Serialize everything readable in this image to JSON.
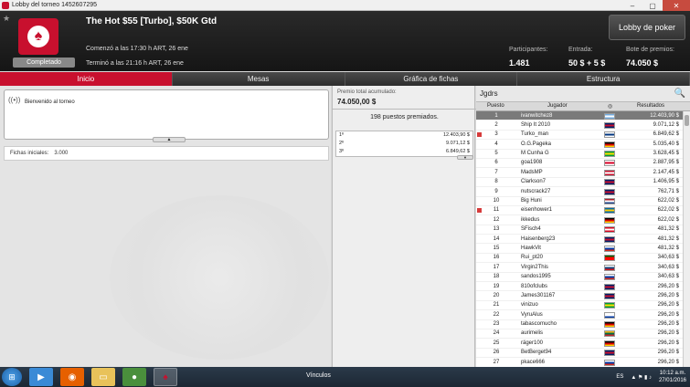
{
  "window": {
    "title": "Lobby del torneo 1452607295",
    "minimize": "–",
    "maximize": "▢",
    "close": "✕"
  },
  "header": {
    "tournament_name": "The Hot $55 [Turbo], $50K Gtd",
    "status": "Completado",
    "start": "Comenzó a las 17:30 h ART, 26 ene",
    "end": "Terminó a las 21:16 h ART, 26 ene",
    "lobby_button": "Lobby de poker",
    "participants_label": "Participantes:",
    "participants_value": "1.481",
    "entry_label": "Entrada:",
    "entry_value": "50 $ + 5 $",
    "prize_label": "Bote de premios:",
    "prize_value": "74.050 $"
  },
  "tabs": [
    {
      "label": "Inicio",
      "active": true
    },
    {
      "label": "Mesas",
      "active": false
    },
    {
      "label": "Gráfica de fichas",
      "active": false
    },
    {
      "label": "Estructura",
      "active": false
    }
  ],
  "left": {
    "news": "Bienvenido al torneo",
    "chips_label": "Fichas iniciales:",
    "chips_value": "3.000"
  },
  "middle": {
    "pool_label": "Premio total acumulado:",
    "pool_value": "74.050,00 $",
    "places_paid": "198 puestos premiados.",
    "payouts": [
      {
        "place": "1º",
        "amount": "12.403,90 $"
      },
      {
        "place": "2º",
        "amount": "9.071,12 $"
      },
      {
        "place": "3º",
        "amount": "6.849,62 $"
      }
    ]
  },
  "right": {
    "title": "Jgdrs",
    "col_pos": "Puesto",
    "col_player": "Jugador",
    "col_results": "Resultados",
    "players": [
      {
        "pos": "1",
        "name": "ivanwitchez8",
        "flag": [
          "#74acdf",
          "#ffffff",
          "#74acdf"
        ],
        "res": "12.403,90 $",
        "sel": true,
        "mark": false
      },
      {
        "pos": "2",
        "name": "Ship It 2010",
        "flag": [
          "#012169",
          "#c8102e",
          "#012169"
        ],
        "res": "9.071,12 $",
        "sel": false,
        "mark": false
      },
      {
        "pos": "3",
        "name": "Turko_man",
        "flag": [
          "#ffffff",
          "#003580",
          "#ffffff"
        ],
        "res": "6.849,62 $",
        "sel": false,
        "mark": true
      },
      {
        "pos": "4",
        "name": "O.G.Pageka",
        "flag": [
          "#000000",
          "#dd0000",
          "#ffce00"
        ],
        "res": "5.035,40 $",
        "sel": false,
        "mark": false
      },
      {
        "pos": "5",
        "name": "M Cunha G",
        "flag": [
          "#009c3b",
          "#ffdf00",
          "#009c3b"
        ],
        "res": "3.628,45 $",
        "sel": false,
        "mark": false
      },
      {
        "pos": "6",
        "name": "goa1908",
        "flag": [
          "#ffffff",
          "#d80027",
          "#ffffff"
        ],
        "res": "2.887,95 $",
        "sel": false,
        "mark": false
      },
      {
        "pos": "7",
        "name": "MadsMP",
        "flag": [
          "#c8102e",
          "#ffffff",
          "#c8102e"
        ],
        "res": "2.147,45 $",
        "sel": false,
        "mark": false
      },
      {
        "pos": "8",
        "name": "Clarkson7",
        "flag": [
          "#012169",
          "#c8102e",
          "#012169"
        ],
        "res": "1.406,95 $",
        "sel": false,
        "mark": false
      },
      {
        "pos": "9",
        "name": "nutscrack27",
        "flag": [
          "#012169",
          "#c8102e",
          "#012169"
        ],
        "res": "762,71 $",
        "sel": false,
        "mark": false
      },
      {
        "pos": "10",
        "name": "Big Huni",
        "flag": [
          "#ae1c28",
          "#ffffff",
          "#21468b"
        ],
        "res": "622,02 $",
        "sel": false,
        "mark": false
      },
      {
        "pos": "11",
        "name": "eisenhower1",
        "flag": [
          "#006aa7",
          "#fecc00",
          "#006aa7"
        ],
        "res": "622,02 $",
        "sel": false,
        "mark": true
      },
      {
        "pos": "12",
        "name": "ikkedus",
        "flag": [
          "#000000",
          "#dd0000",
          "#ffce00"
        ],
        "res": "622,02 $",
        "sel": false,
        "mark": false
      },
      {
        "pos": "13",
        "name": "SFisch4",
        "flag": [
          "#d80621",
          "#ffffff",
          "#d80621"
        ],
        "res": "481,32 $",
        "sel": false,
        "mark": false
      },
      {
        "pos": "14",
        "name": "Haisenberg23",
        "flag": [
          "#012169",
          "#c8102e",
          "#012169"
        ],
        "res": "481,32 $",
        "sel": false,
        "mark": false
      },
      {
        "pos": "15",
        "name": "HawkVit",
        "flag": [
          "#ffffff",
          "#0039a6",
          "#d52b1e"
        ],
        "res": "481,32 $",
        "sel": false,
        "mark": false
      },
      {
        "pos": "16",
        "name": "Rui_pt20",
        "flag": [
          "#006600",
          "#ff0000",
          "#ff0000"
        ],
        "res": "340,63 $",
        "sel": false,
        "mark": false
      },
      {
        "pos": "17",
        "name": "Virgin2This",
        "flag": [
          "#ffffff",
          "#11457e",
          "#d7141a"
        ],
        "res": "340,63 $",
        "sel": false,
        "mark": false
      },
      {
        "pos": "18",
        "name": "sandos1995",
        "flag": [
          "#ffffff",
          "#0039a6",
          "#d52b1e"
        ],
        "res": "340,63 $",
        "sel": false,
        "mark": false
      },
      {
        "pos": "19",
        "name": "810ofclubs",
        "flag": [
          "#012169",
          "#c8102e",
          "#012169"
        ],
        "res": "296,20 $",
        "sel": false,
        "mark": false
      },
      {
        "pos": "20",
        "name": "James301167",
        "flag": [
          "#012169",
          "#c8102e",
          "#012169"
        ],
        "res": "296,20 $",
        "sel": false,
        "mark": false
      },
      {
        "pos": "21",
        "name": "vinizuo",
        "flag": [
          "#009c3b",
          "#ffdf00",
          "#009c3b"
        ],
        "res": "296,20 $",
        "sel": false,
        "mark": false
      },
      {
        "pos": "22",
        "name": "VyruAlus",
        "flag": [
          "#ffffff",
          "#ffffff",
          "#0039a6"
        ],
        "res": "296,20 $",
        "sel": false,
        "mark": false
      },
      {
        "pos": "23",
        "name": "tabascomucho",
        "flag": [
          "#000000",
          "#dd0000",
          "#ffce00"
        ],
        "res": "296,20 $",
        "sel": false,
        "mark": false
      },
      {
        "pos": "24",
        "name": "aurimelis",
        "flag": [
          "#fdb913",
          "#006a44",
          "#c1272d"
        ],
        "res": "296,20 $",
        "sel": false,
        "mark": false
      },
      {
        "pos": "25",
        "name": "räger100",
        "flag": [
          "#000000",
          "#dd0000",
          "#ffce00"
        ],
        "res": "296,20 $",
        "sel": false,
        "mark": false
      },
      {
        "pos": "26",
        "name": "BetBerget94",
        "flag": [
          "#012169",
          "#c8102e",
          "#012169"
        ],
        "res": "296,20 $",
        "sel": false,
        "mark": false
      },
      {
        "pos": "27",
        "name": "pkace666",
        "flag": [
          "#ffffff",
          "#0039a6",
          "#d52b1e"
        ],
        "res": "296,20 $",
        "sel": false,
        "mark": false
      }
    ]
  },
  "taskbar": {
    "vinculos": "Vínculos",
    "lang": "ES",
    "time": "10:12 a.m.",
    "date": "27/01/2016"
  }
}
